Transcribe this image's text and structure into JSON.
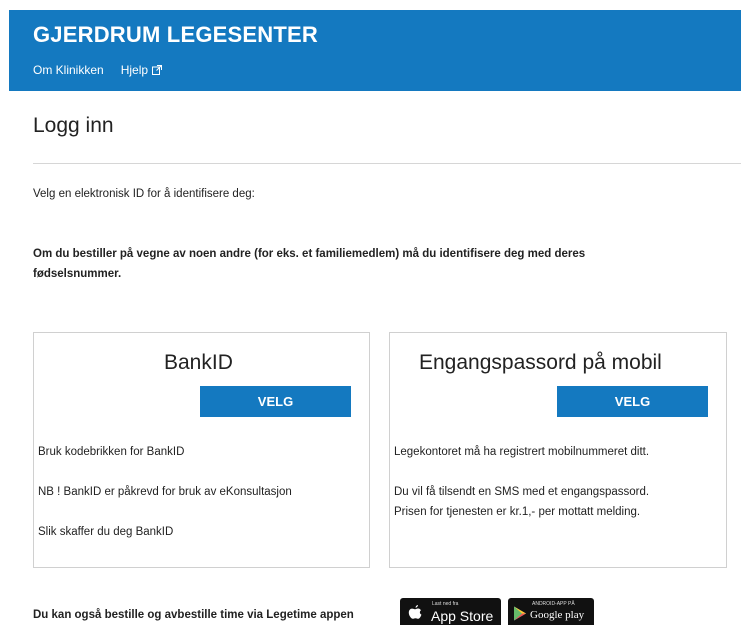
{
  "header": {
    "brand": "GJERDRUM LEGESENTER",
    "nav": [
      {
        "label": "Om Klinikken"
      },
      {
        "label": "Hjelp"
      }
    ]
  },
  "page": {
    "title": "Logg inn",
    "intro": "Velg en elektronisk ID for å identifisere deg:",
    "notice": "Om du bestiller på vegne av noen andre (for eks. et familiemedlem) må du identifisere deg med deres fødselsnummer."
  },
  "bankid_card": {
    "title": "BankID",
    "button": "VELG",
    "line1": "Bruk kodebrikken for BankID",
    "line2": "NB ! BankID er påkrevd for bruk av eKonsultasjon",
    "link": "Slik skaffer du deg BankID"
  },
  "otp_card": {
    "title": "Engangspassord på mobil",
    "button": "VELG",
    "line1": "Legekontoret må ha registrert mobilnummeret ditt.",
    "line2": "Du vil få tilsendt en SMS med et engangspassord.",
    "line3": "Prisen for tjenesten er kr.1,- per mottatt melding."
  },
  "footer": {
    "text": "Du kan også bestille og avbestille time via Legetime appen",
    "app_store": {
      "small": "Last ned fra",
      "big": "App Store",
      "icon": "apple-icon"
    },
    "google_play": {
      "small": "ANDROID-APP PÅ",
      "big": "Google play",
      "icon": "play-icon"
    }
  },
  "colors": {
    "header_bg": "#1479c0",
    "button_bg": "#1479c0",
    "badge_bg": "#111111"
  }
}
